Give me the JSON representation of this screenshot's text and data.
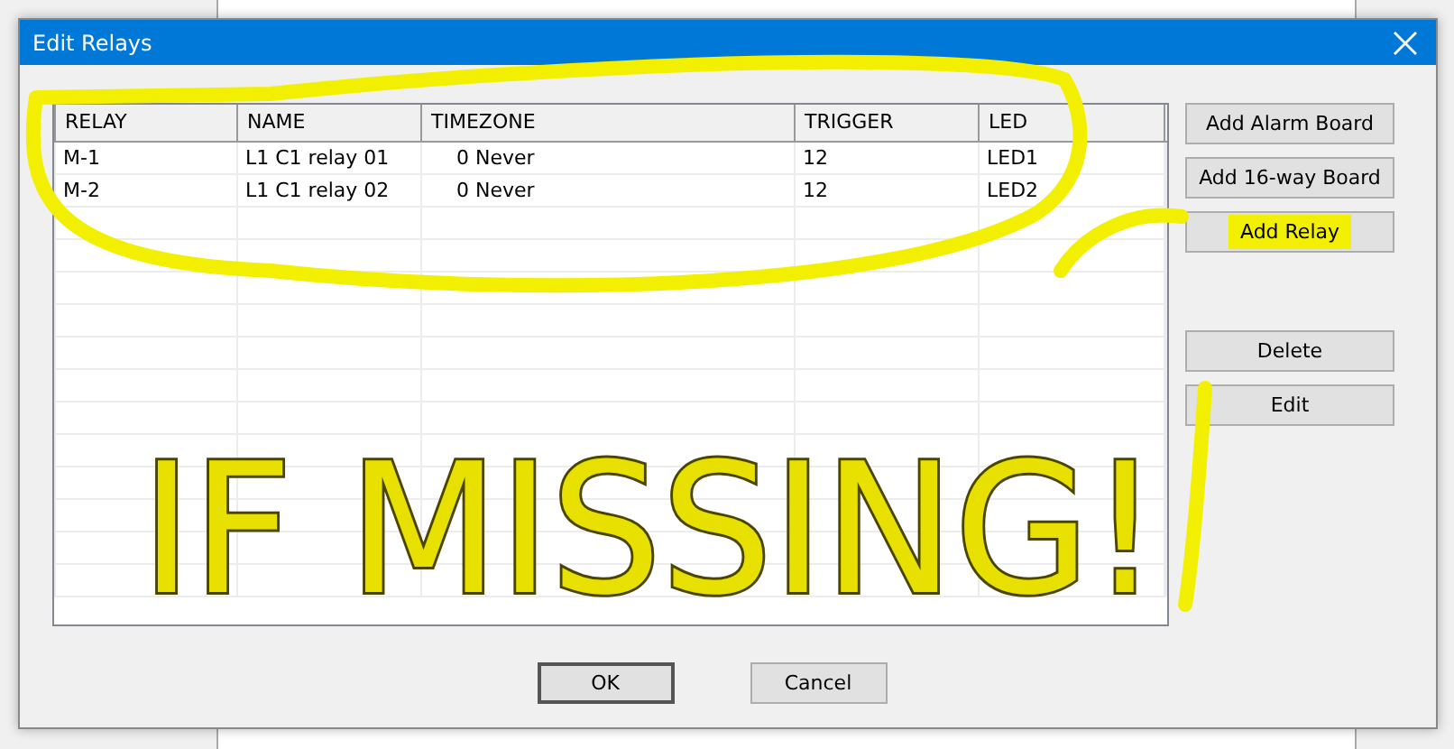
{
  "window": {
    "title": "Edit Relays"
  },
  "table": {
    "columns": [
      "RELAY",
      "NAME",
      "TIMEZONE",
      "TRIGGER",
      "LED"
    ],
    "rows": [
      [
        "M-1",
        "L1 C1 relay 01",
        "0 Never",
        "12",
        "LED1"
      ],
      [
        "M-2",
        "L1 C1 relay 02",
        "0 Never",
        "12",
        "LED2"
      ]
    ]
  },
  "side_buttons": [
    {
      "label": "Add Alarm Board",
      "highlighted": false
    },
    {
      "label": "Add 16-way Board",
      "highlighted": false
    },
    {
      "label": "Add Relay",
      "highlighted": true
    },
    {
      "label": "Delete",
      "highlighted": false
    },
    {
      "label": "Edit",
      "highlighted": false
    }
  ],
  "buttons": [
    {
      "label": "OK",
      "default": true
    },
    {
      "label": "Cancel",
      "default": false
    }
  ],
  "annotation": {
    "text": "IF MISSING!"
  }
}
